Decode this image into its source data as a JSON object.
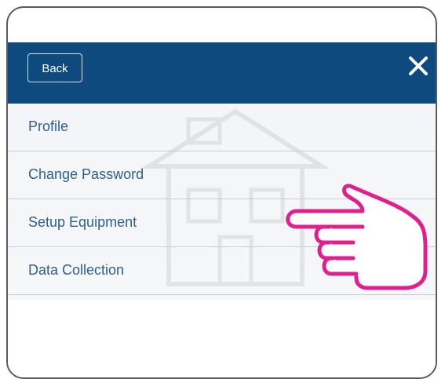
{
  "header": {
    "back_label": "Back",
    "close_icon": "close-icon",
    "background_color": "#0e4a7e"
  },
  "menu": {
    "items": [
      {
        "label": "Profile"
      },
      {
        "label": "Change Password"
      },
      {
        "label": "Setup Equipment"
      },
      {
        "label": "Data Collection"
      }
    ],
    "text_color": "#2d5f8f"
  },
  "annotation": {
    "icon": "pointing-hand-icon",
    "color": "#e0208e",
    "points_to": "Setup Equipment"
  }
}
